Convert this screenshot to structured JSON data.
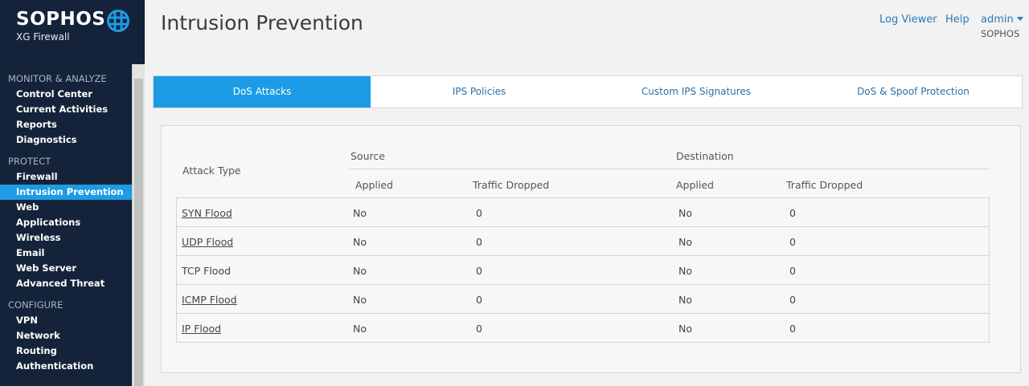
{
  "brand": {
    "name": "SOPHOS",
    "product": "XG Firewall"
  },
  "sidebar": {
    "sections": [
      {
        "title": "MONITOR & ANALYZE",
        "items": [
          "Control Center",
          "Current Activities",
          "Reports",
          "Diagnostics"
        ]
      },
      {
        "title": "PROTECT",
        "items": [
          "Firewall",
          "Intrusion Prevention",
          "Web",
          "Applications",
          "Wireless",
          "Email",
          "Web Server",
          "Advanced Threat"
        ]
      },
      {
        "title": "CONFIGURE",
        "items": [
          "VPN",
          "Network",
          "Routing",
          "Authentication"
        ]
      }
    ],
    "active_item": "Intrusion Prevention"
  },
  "header": {
    "title": "Intrusion Prevention",
    "log_viewer": "Log Viewer",
    "help": "Help",
    "user": "admin",
    "org": "SOPHOS"
  },
  "tabs": [
    "DoS Attacks",
    "IPS Policies",
    "Custom IPS Signatures",
    "DoS & Spoof Protection"
  ],
  "table": {
    "attack_type_header": "Attack Type",
    "source_header": "Source",
    "destination_header": "Destination",
    "applied_header": "Applied",
    "dropped_header": "Traffic Dropped",
    "rows": [
      {
        "type": "SYN Flood",
        "link": true,
        "src_applied": "No",
        "src_dropped": "0",
        "dst_applied": "No",
        "dst_dropped": "0"
      },
      {
        "type": "UDP Flood",
        "link": true,
        "src_applied": "No",
        "src_dropped": "0",
        "dst_applied": "No",
        "dst_dropped": "0"
      },
      {
        "type": "TCP Flood",
        "link": false,
        "src_applied": "No",
        "src_dropped": "0",
        "dst_applied": "No",
        "dst_dropped": "0"
      },
      {
        "type": "ICMP Flood",
        "link": true,
        "src_applied": "No",
        "src_dropped": "0",
        "dst_applied": "No",
        "dst_dropped": "0"
      },
      {
        "type": "IP Flood",
        "link": true,
        "src_applied": "No",
        "src_dropped": "0",
        "dst_applied": "No",
        "dst_dropped": "0"
      }
    ]
  },
  "colors": {
    "sidebar_bg": "#14233a",
    "accent": "#1d9ce5",
    "link": "#2a7ab8"
  }
}
